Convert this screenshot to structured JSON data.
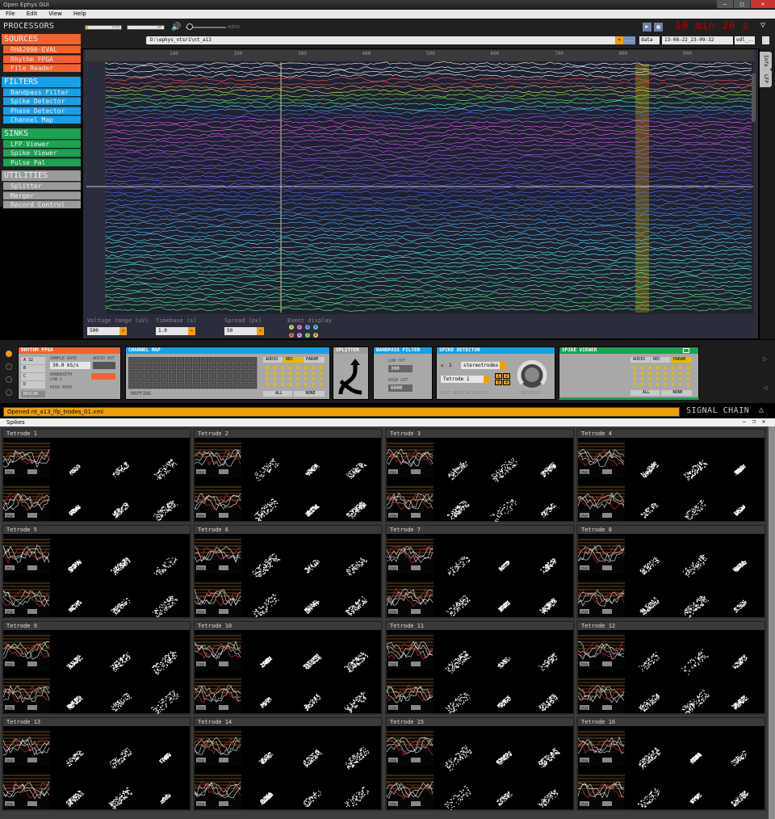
{
  "window": {
    "title": "Open Ephys GUI"
  },
  "menu": [
    "File",
    "Edit",
    "View",
    "Help"
  ],
  "control_bar": {
    "processors_label": "PROCESSORS",
    "cpu_label": "CPU",
    "disk_label": "DF",
    "audio_label": "AUDIO",
    "clock": "10 min 26 s",
    "collapse_symbol": "▽"
  },
  "record_path": {
    "path": "D:\\ephys_ntsr1\\nt_a13",
    "browse": "...",
    "prefix": "data",
    "date": "13-08-22_23-09-32",
    "suffix": "odl_..."
  },
  "processor_list": [
    {
      "category": "SOURCES",
      "color": "#f2622e",
      "items": [
        "RHA2000-EVAL",
        "Rhythm FPGA",
        "File Reader"
      ]
    },
    {
      "category": "FILTERS",
      "color": "#15a1e8",
      "items": [
        "Bandpass Filter",
        "Spike Detector",
        "Phase Detector",
        "Channel Map"
      ]
    },
    {
      "category": "SINKS",
      "color": "#1aa351",
      "items": [
        "LFP Viewer",
        "Spike Viewer",
        "Pulse Pal"
      ]
    },
    {
      "category": "UTILITIES",
      "color": "#9b9b9b",
      "items": [
        "Splitter",
        "Merger",
        "Record Control"
      ]
    }
  ],
  "lfp_viewer": {
    "time_ticks": [
      "100",
      "200",
      "300",
      "400",
      "500",
      "600",
      "700",
      "800",
      "900"
    ],
    "tabs": [
      "Info",
      "LFP"
    ],
    "voltage_range_label": "Voltage range (uV)",
    "voltage_range_value": "500",
    "timebase_label": "Timebase (s)",
    "timebase_value": "1.0",
    "spread_label": "Spread (px)",
    "spread_value": "50",
    "event_display_label": "Event display",
    "event_channels": [
      "1",
      "2",
      "3",
      "4",
      "5",
      "6",
      "7",
      "8"
    ],
    "event_colors": [
      "#c8e05a",
      "#e07fd4",
      "#7f9fe0",
      "#61c0e0",
      "#e07070",
      "#d8a0ff",
      "#7ad07a",
      "#e0c860"
    ]
  },
  "signal_chain": {
    "rhythm_fpga": {
      "title": "RHYTHM FPGA",
      "ports": [
        "A",
        "B",
        "C",
        "D"
      ],
      "channels_A": "32",
      "sample_rate_label": "SAMPLE RATE",
      "sample_rate": "30.0 kS/s",
      "audio_label": "AUDIO OUT",
      "bandwidth_label": "BANDWIDTH",
      "low_label": "LOW",
      "low_value": "1",
      "high_label": "HIGH",
      "high_value": "8850",
      "rescan": "RESCAN"
    },
    "channel_map": {
      "title": "CHANNEL MAP",
      "mapping_label": "MAPPING",
      "tabs": [
        "AUDIO",
        "REC",
        "PARAM"
      ],
      "buttons": [
        "ALL",
        "NONE"
      ]
    },
    "splitter": {
      "title": "SPLITTER"
    },
    "bandpass": {
      "title": "BANDPASS FILTER",
      "low_label": "LOW CUT",
      "low_value": "300",
      "high_label": "HIGH CUT",
      "high_value": "6000"
    },
    "spike_detector": {
      "title": "SPIKE DETECTOR",
      "count": "1",
      "type": "stereotrodes",
      "electrode": "Tetrode 1",
      "threshold_label": "THRESHOLD",
      "actions": [
        "EDIT",
        "MONITOR",
        "DELETE"
      ],
      "channels": [
        "1",
        "2",
        "3",
        "4"
      ]
    },
    "spike_viewer": {
      "title": "SPIKE VIEWER",
      "tabs": [
        "AUDIO",
        "REC",
        "PARAM"
      ],
      "buttons": [
        "ALL",
        "NONE"
      ]
    },
    "status": "Opened nt_a13_lfp_trodes_01.xml",
    "label": "SIGNAL CHAIN",
    "toggle_symbol": "△"
  },
  "spikes_window": {
    "title": "Spikes",
    "tetrodes": [
      "Tetrode 1",
      "Tetrode 2",
      "Tetrode 3",
      "Tetrode 4",
      "Tetrode 5",
      "Tetrode 6",
      "Tetrode 7",
      "Tetrode 8",
      "Tetrode 9",
      "Tetrode 10",
      "Tetrode 11",
      "Tetrode 12",
      "Tetrode 13",
      "Tetrode 14",
      "Tetrode 15",
      "Tetrode 16"
    ],
    "threshold_value": "250"
  }
}
